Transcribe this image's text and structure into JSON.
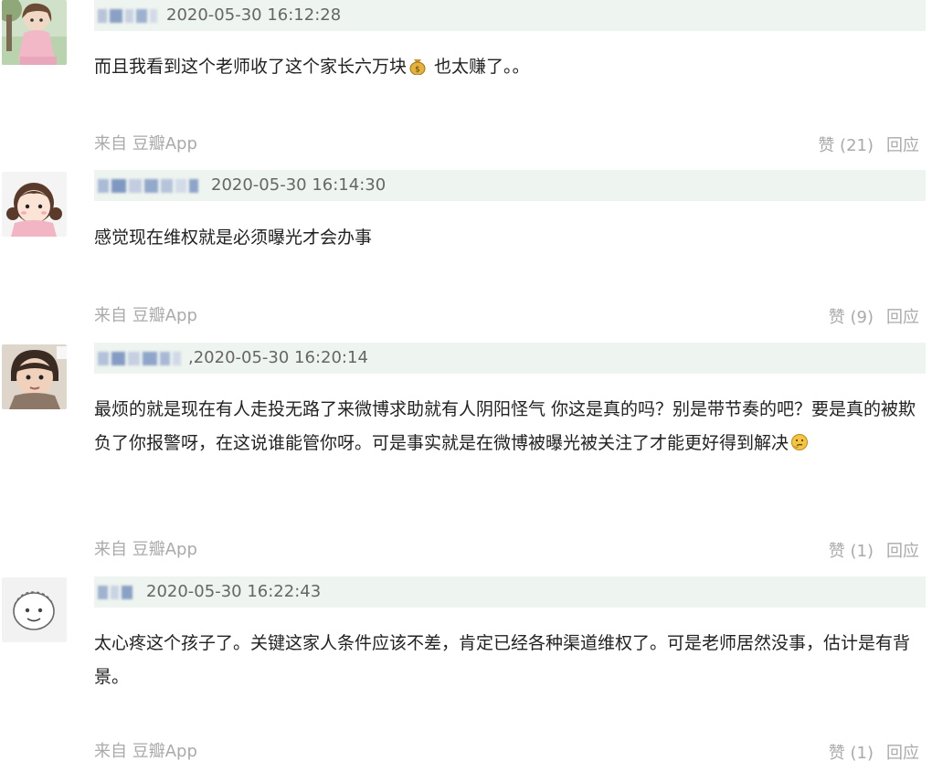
{
  "comments": [
    {
      "timestamp": "2020-05-30 16:12:28",
      "text": "而且我看到这个老师收了这个家长六万块",
      "text_after_emoji": " 也太赚了。。",
      "emoji": "money-bag",
      "source": "来自 豆瓣App",
      "like_label": "赞 (21)",
      "reply_label": "回应"
    },
    {
      "timestamp": "2020-05-30 16:14:30",
      "text": "感觉现在维权就是必须曝光才会办事",
      "source": "来自 豆瓣App",
      "like_label": "赞 (9)",
      "reply_label": "回应"
    },
    {
      "timestamp": ",2020-05-30 16:20:14",
      "text": "最烦的就是现在有人走投无路了来微博求助就有人阴阳怪气 你这是真的吗？别是带节奏的吧？要是真的被欺负了你报警呀，在这说谁能管你呀。可是事实就是在微博被曝光被关注了才能更好得到解决",
      "emoji": "thinking-face",
      "source": "来自 豆瓣App",
      "like_label": "赞 (1)",
      "reply_label": "回应"
    },
    {
      "timestamp": "2020-05-30 16:22:43",
      "text": "太心疼这个孩子了。关键这家人条件应该不差，肯定已经各种渠道维权了。可是老师居然没事，估计是有背景。",
      "source": "来自 豆瓣App",
      "like_label": "赞 (1)",
      "reply_label": "回应"
    }
  ]
}
